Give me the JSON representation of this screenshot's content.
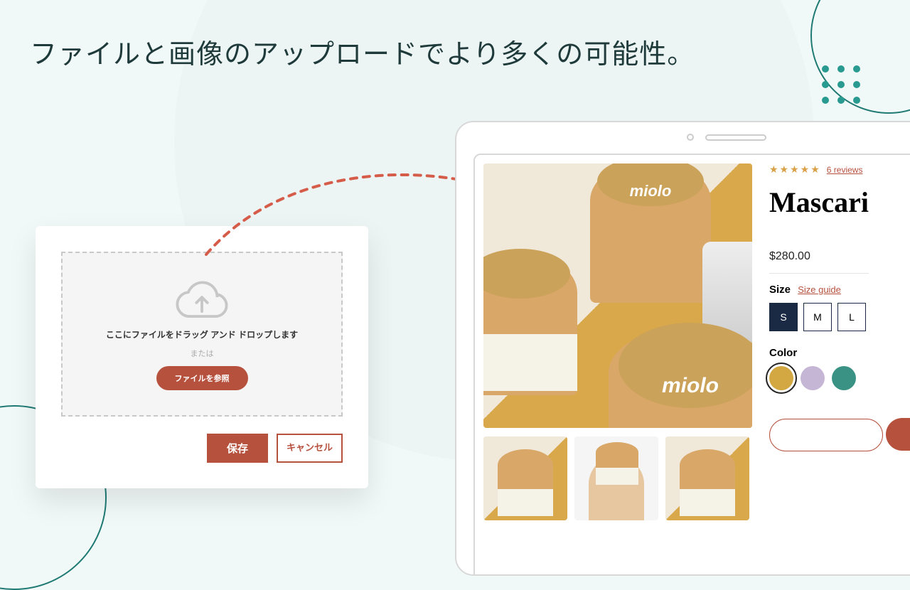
{
  "headline": "ファイルと画像のアップロードでより多くの可能性。",
  "upload": {
    "drop_text": "ここにファイルをドラッグ アンド ドロップします",
    "or_text": "または",
    "browse_label": "ファイルを参照",
    "save_label": "保存",
    "cancel_label": "キャンセル"
  },
  "product": {
    "reviews_link": "6 reviews",
    "title": "Mascari",
    "brand_on_image": "miolo",
    "price": "$280.00",
    "size_label": "Size",
    "size_guide": "Size guide",
    "sizes": [
      "S",
      "M",
      "L"
    ],
    "selected_size": "S",
    "color_label": "Color",
    "colors": {
      "gold": "#d3a842",
      "lilac": "#c6b6d6",
      "teal": "#3a9284"
    },
    "selected_color": "gold"
  }
}
